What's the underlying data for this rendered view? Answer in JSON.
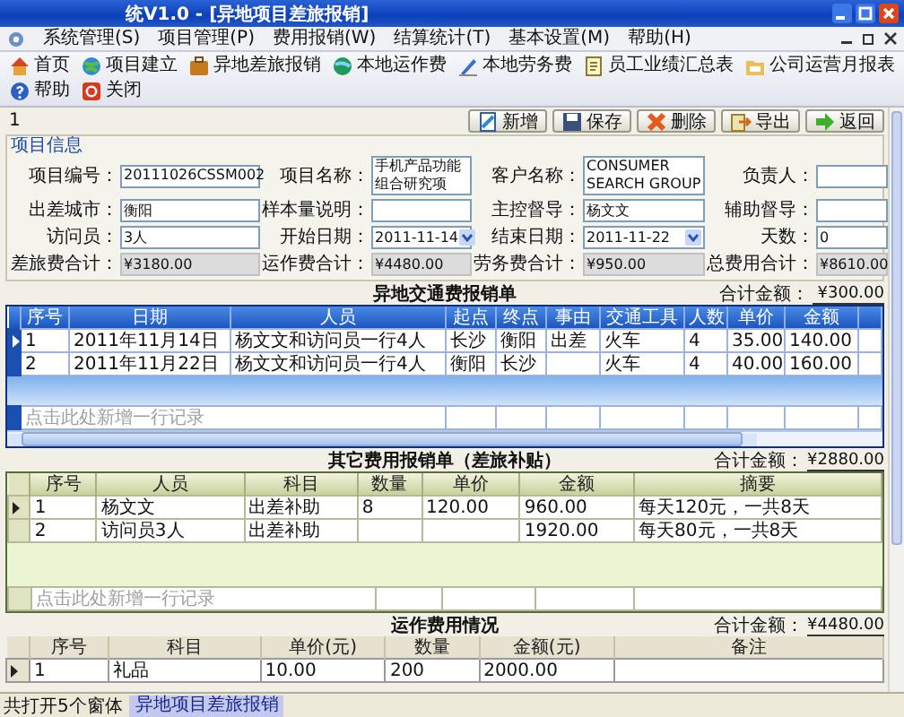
{
  "window": {
    "title": "统V1.0 - [异地项目差旅报销]"
  },
  "menu": [
    "系统管理(S)",
    "项目管理(P)",
    "费用报销(W)",
    "结算统计(T)",
    "基本设置(M)",
    "帮助(H)"
  ],
  "toolbar": [
    "首页",
    "项目建立",
    "异地差旅报销",
    "本地运作费",
    "本地劳务费",
    "员工业绩汇总表",
    "公司运营月报表",
    "帮助",
    "关闭"
  ],
  "record": {
    "number": "1",
    "buttons": [
      "新增",
      "保存",
      "删除",
      "导出",
      "返回"
    ]
  },
  "project_info": {
    "title": "项目信息",
    "fields": [
      {
        "label": "项目编号：",
        "value": "20111026CSSM002",
        "kind": "text"
      },
      {
        "label": "项目名称：",
        "value": "手机产品功能组合研究项",
        "kind": "text"
      },
      {
        "label": "客户名称：",
        "value": "CONSUMER SEARCH GROUP",
        "kind": "text"
      },
      {
        "label": "负责人：",
        "kind": "text"
      },
      {
        "label": "出差城市：",
        "value": "衡阳",
        "kind": "text"
      },
      {
        "label": "样本量说明：",
        "kind": "text"
      },
      {
        "label": "主控督导：",
        "value": "杨文文",
        "kind": "text"
      },
      {
        "label": "辅助督导：",
        "kind": "text"
      },
      {
        "label": "访问员：",
        "value": "3人",
        "kind": "text"
      },
      {
        "label": "开始日期：",
        "value": "2011-11-14",
        "kind": "date"
      },
      {
        "label": "结束日期：",
        "value": "2011-11-22",
        "kind": "date"
      },
      {
        "label": "天数：",
        "value": "0",
        "kind": "text"
      },
      {
        "label": "差旅费合计：",
        "value": "¥3180.00",
        "kind": "total"
      },
      {
        "label": "运作费合计：",
        "value": "¥4480.00",
        "kind": "total"
      },
      {
        "label": "劳务费合计：",
        "value": "¥950.00",
        "kind": "total"
      },
      {
        "label": "总费用合计：",
        "value": "¥8610.00",
        "kind": "total"
      }
    ]
  },
  "forms": [
    {
      "kind": "travel",
      "title": "异地交通费报销单",
      "total_label": "合计金额：",
      "total": "¥300.00",
      "columns": [
        "序号",
        "日期",
        "人员",
        "起点",
        "终点",
        "事由",
        "交通工具",
        "人数",
        "单价",
        "金额"
      ],
      "rows": [
        {
          "selected": true,
          "cells": [
            "1",
            "2011年11月14日",
            "杨文文和访问员一行4人",
            "长沙",
            "衡阳",
            "出差",
            "火车",
            "4",
            "35.00",
            "140.00"
          ]
        },
        {
          "selected": false,
          "cells": [
            "2",
            "2011年11月22日",
            "杨文文和访问员一行4人",
            "衡阳",
            "长沙",
            null,
            "火车",
            "4",
            "40.00",
            "160.00"
          ]
        }
      ],
      "new_row_hint": "点击此处新增一行记录"
    },
    {
      "kind": "other",
      "title": "其它费用报销单（差旅补贴）",
      "total_label": "合计金额：",
      "total": "¥2880.00",
      "columns": [
        "序号",
        "人员",
        "科目",
        "数量",
        "单价",
        "金额",
        "摘要"
      ],
      "rows": [
        {
          "selected": true,
          "cells": [
            "1",
            "杨文文",
            "出差补助",
            "8",
            "120.00",
            "960.00",
            "每天120元，一共8天"
          ]
        },
        {
          "selected": false,
          "cells": [
            "2",
            "访问员3人",
            "出差补助",
            null,
            null,
            "1920.00",
            "每天80元，一共8天"
          ]
        }
      ],
      "new_row_hint": "点击此处新增一行记录"
    },
    {
      "kind": "operation",
      "title": "运作费用情况",
      "total_label": "合计金额：",
      "total": "¥4480.00",
      "columns": [
        "序号",
        "科目",
        "单价(元)",
        "数量",
        "金额(元)",
        "备注"
      ],
      "rows": [
        {
          "selected": true,
          "cells": [
            "1",
            "礼品",
            "10.00",
            "200",
            "2000.00",
            null
          ]
        }
      ]
    }
  ],
  "status_bar": {
    "text": "共打开5个窗体",
    "windows": [
      {
        "label": "异地项目差旅报销",
        "selected": true
      }
    ]
  }
}
